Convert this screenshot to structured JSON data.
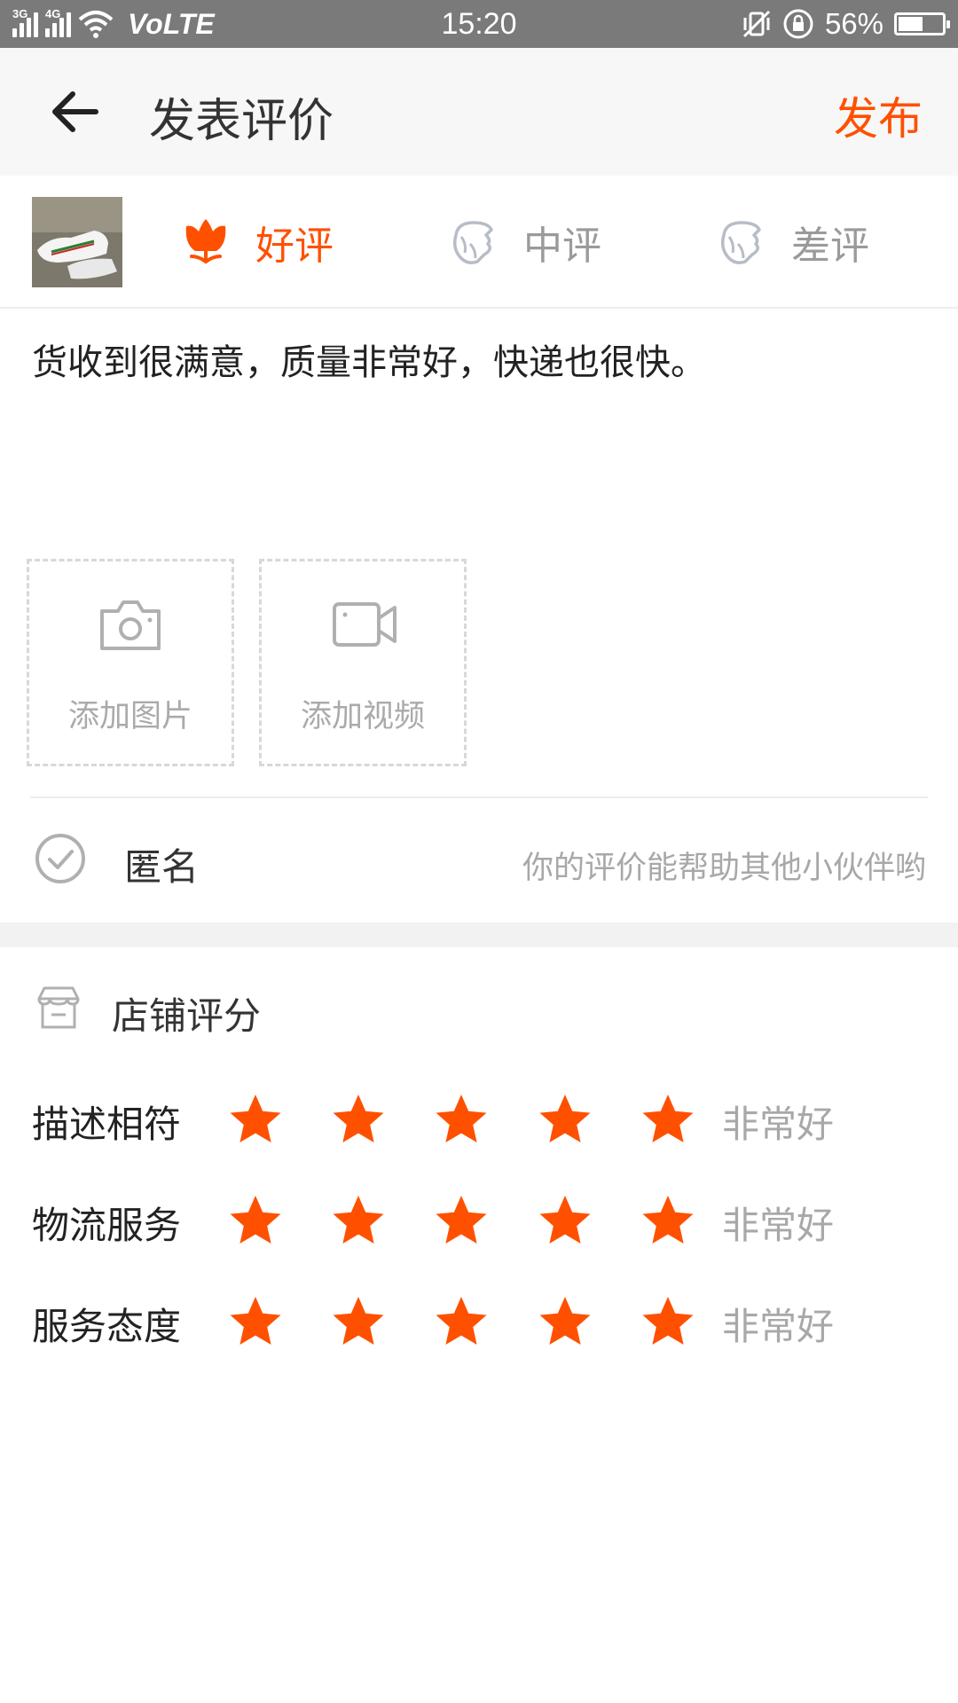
{
  "status_bar": {
    "net1": "3G",
    "net2": "4G",
    "volte": "VoLTE",
    "time": "15:20",
    "battery": "56%",
    "battery_level": 0.56
  },
  "header": {
    "title": "发表评价",
    "publish_label": "发布"
  },
  "rating_options": [
    {
      "label": "好评",
      "selected": true
    },
    {
      "label": "中评",
      "selected": false
    },
    {
      "label": "差评",
      "selected": false
    }
  ],
  "review_text": "货收到很满意，质量非常好，快递也很快。",
  "media": {
    "add_photo": "添加图片",
    "add_video": "添加视频"
  },
  "anonymous": {
    "label": "匿名",
    "hint": "你的评价能帮助其他小伙伴哟"
  },
  "shop_rating": {
    "title": "店铺评分",
    "rows": [
      {
        "label": "描述相符",
        "stars": 5,
        "text": "非常好"
      },
      {
        "label": "物流服务",
        "stars": 5,
        "text": "非常好"
      },
      {
        "label": "服务态度",
        "stars": 5,
        "text": "非常好"
      }
    ]
  },
  "colors": {
    "accent": "#ff5000",
    "muted": "#a8a8a8",
    "status_bar": "#7a7a7a"
  }
}
